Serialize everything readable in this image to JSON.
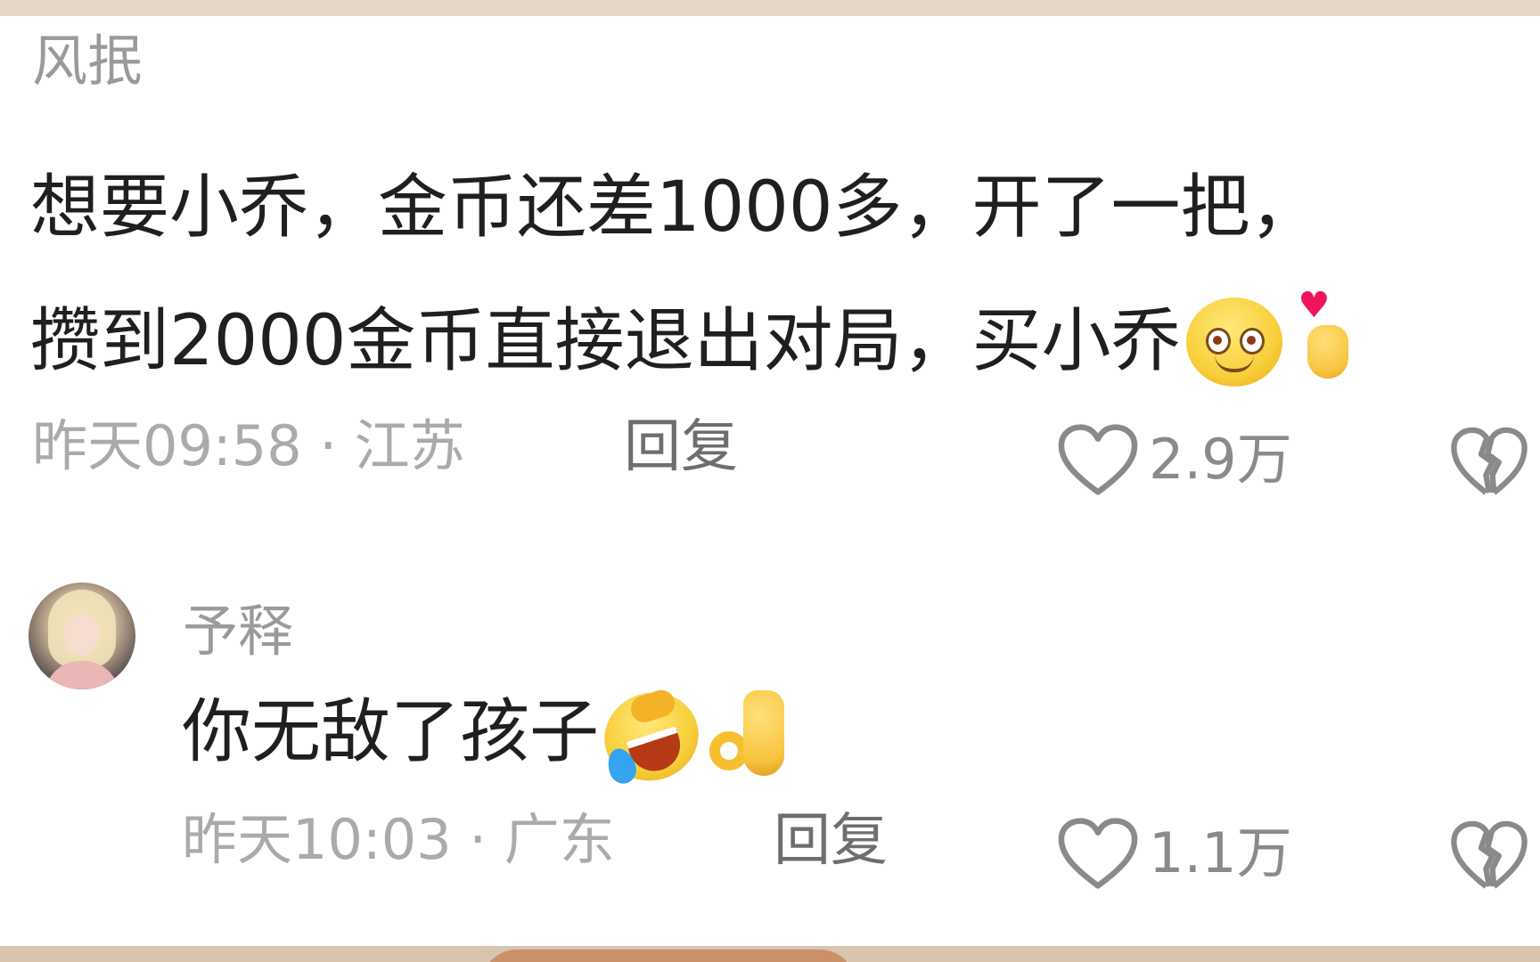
{
  "colors": {
    "background": "#ffffff",
    "frame": "#e9dccf",
    "username": "#9a9a9a",
    "body_text": "#1f1f1f",
    "meta_text": "#aaaaaa",
    "reply_text": "#6e6e6e"
  },
  "comments": [
    {
      "username": "风抿",
      "lines": [
        "想要小乔，金币还差1000多，开了一把，",
        "攒到2000金币直接退出对局，买小乔"
      ],
      "emojis": [
        "blush-smile-emoji",
        "finger-heart-emoji"
      ],
      "time": "昨天09:58 · 江苏",
      "reply_label": "回复",
      "likes": "2.9万",
      "icons": {
        "like": "heart-outline-icon",
        "dislike": "broken-heart-icon"
      }
    },
    {
      "username": "予释",
      "avatar": "avatar-photo",
      "lines": [
        "你无敌了孩子"
      ],
      "emojis": [
        "laugh-cry-emoji",
        "ok-hand-emoji"
      ],
      "time": "昨天10:03 · 广东",
      "reply_label": "回复",
      "likes": "1.1万",
      "icons": {
        "like": "heart-outline-icon",
        "dislike": "broken-heart-icon"
      }
    }
  ]
}
